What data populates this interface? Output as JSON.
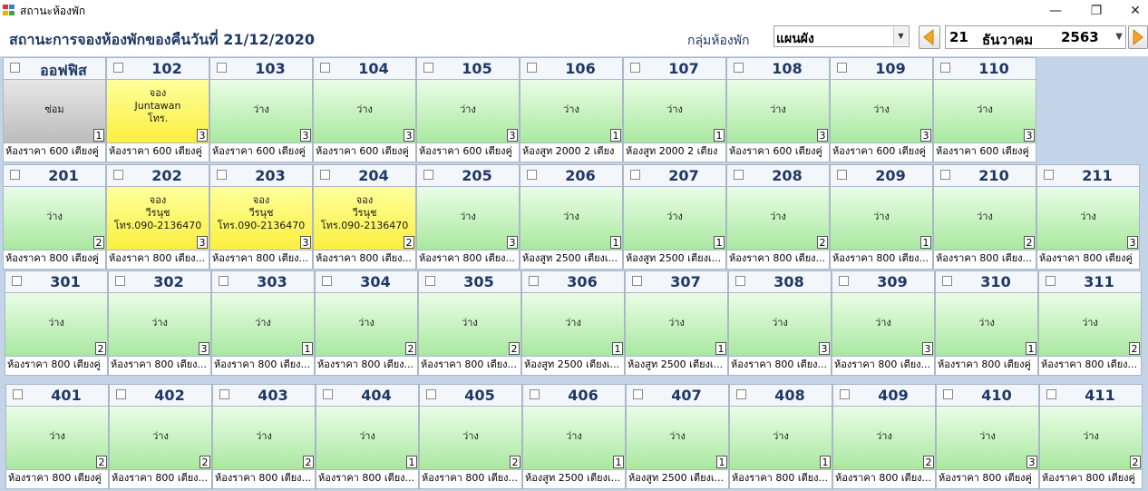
{
  "window": {
    "title": "สถานะห้องพัก",
    "minimize": "—",
    "restore": "❐",
    "close": "✕"
  },
  "header": {
    "title": "สถานะการจองห้องพักของคืนวันที่ 21/12/2020",
    "group_label": "กลุ่มห้องพัก",
    "group_value": "แผนผัง",
    "date_day": "21",
    "date_month": "ธันวาคม",
    "date_year": "2563"
  },
  "colors": {
    "available": "#b5ecac",
    "booked": "#fcf24a",
    "repair": "#c8c8c8",
    "accent": "#1f3864"
  },
  "floors": [
    {
      "rooms": [
        {
          "number": "ออฟฟิส",
          "status": "ซ่อม",
          "state": "repair",
          "beds": "1",
          "type": "ห้องราคา 600 เตียงคู่"
        },
        {
          "number": "102",
          "status": "จอง\nJuntawan\nโทร.",
          "state": "booked",
          "beds": "3",
          "type": "ห้องราคา 600 เตียงคู่"
        },
        {
          "number": "103",
          "status": "ว่าง",
          "state": "avail",
          "beds": "3",
          "type": "ห้องราคา 600 เตียงคู่"
        },
        {
          "number": "104",
          "status": "ว่าง",
          "state": "avail",
          "beds": "3",
          "type": "ห้องราคา 600 เตียงคู่"
        },
        {
          "number": "105",
          "status": "ว่าง",
          "state": "avail",
          "beds": "3",
          "type": "ห้องราคา 600 เตียงคู่"
        },
        {
          "number": "106",
          "status": "ว่าง",
          "state": "avail",
          "beds": "1",
          "type": "ห้องสูท 2000 2 เตียง"
        },
        {
          "number": "107",
          "status": "ว่าง",
          "state": "avail",
          "beds": "1",
          "type": "ห้องสูท 2000 2 เตียง"
        },
        {
          "number": "108",
          "status": "ว่าง",
          "state": "avail",
          "beds": "3",
          "type": "ห้องราคา 600 เตียงคู่"
        },
        {
          "number": "109",
          "status": "ว่าง",
          "state": "avail",
          "beds": "3",
          "type": "ห้องราคา 600 เตียงคู่"
        },
        {
          "number": "110",
          "status": "ว่าง",
          "state": "avail",
          "beds": "3",
          "type": "ห้องราคา 600 เตียงคู่"
        }
      ]
    },
    {
      "rooms": [
        {
          "number": "201",
          "status": "ว่าง",
          "state": "avail",
          "beds": "2",
          "type": "ห้องราคา 800 เตียงคู่"
        },
        {
          "number": "202",
          "status": "จอง\nวีรนุช\nโทร.090-2136470",
          "state": "booked",
          "beds": "3",
          "type": "ห้องราคา 800 เตียง..."
        },
        {
          "number": "203",
          "status": "จอง\nวีรนุช\nโทร.090-2136470",
          "state": "booked",
          "beds": "3",
          "type": "ห้องราคา 800 เตียง..."
        },
        {
          "number": "204",
          "status": "จอง\nวีรนุช\nโทร.090-2136470",
          "state": "booked",
          "beds": "2",
          "type": "ห้องราคา 800 เตียง..."
        },
        {
          "number": "205",
          "status": "ว่าง",
          "state": "avail",
          "beds": "3",
          "type": "ห้องราคา 800 เตียง..."
        },
        {
          "number": "206",
          "status": "ว่าง",
          "state": "avail",
          "beds": "1",
          "type": "ห้องสูท 2500 เตียงเ..."
        },
        {
          "number": "207",
          "status": "ว่าง",
          "state": "avail",
          "beds": "1",
          "type": "ห้องสูท 2500 เตียงเ..."
        },
        {
          "number": "208",
          "status": "ว่าง",
          "state": "avail",
          "beds": "2",
          "type": "ห้องราคา 800 เตียง..."
        },
        {
          "number": "209",
          "status": "ว่าง",
          "state": "avail",
          "beds": "1",
          "type": "ห้องราคา 800 เตียง..."
        },
        {
          "number": "210",
          "status": "ว่าง",
          "state": "avail",
          "beds": "2",
          "type": "ห้องราคา 800 เตียง..."
        },
        {
          "number": "211",
          "status": "ว่าง",
          "state": "avail",
          "beds": "3",
          "type": "ห้องราคา 800 เตียงคู่"
        }
      ]
    },
    {
      "rooms": [
        {
          "number": "301",
          "status": "ว่าง",
          "state": "avail",
          "beds": "2",
          "type": "ห้องราคา 800 เตียงคู่"
        },
        {
          "number": "302",
          "status": "ว่าง",
          "state": "avail",
          "beds": "3",
          "type": "ห้องราคา 800 เตียง..."
        },
        {
          "number": "303",
          "status": "ว่าง",
          "state": "avail",
          "beds": "1",
          "type": "ห้องราคา 800 เตียง..."
        },
        {
          "number": "304",
          "status": "ว่าง",
          "state": "avail",
          "beds": "2",
          "type": "ห้องราคา 800 เตียง..."
        },
        {
          "number": "305",
          "status": "ว่าง",
          "state": "avail",
          "beds": "2",
          "type": "ห้องราคา 800 เตียง..."
        },
        {
          "number": "306",
          "status": "ว่าง",
          "state": "avail",
          "beds": "1",
          "type": "ห้องสูท 2500 เตียงเ..."
        },
        {
          "number": "307",
          "status": "ว่าง",
          "state": "avail",
          "beds": "1",
          "type": "ห้องสูท 2500 เตียงเ..."
        },
        {
          "number": "308",
          "status": "ว่าง",
          "state": "avail",
          "beds": "3",
          "type": "ห้องราคา 800 เตียง..."
        },
        {
          "number": "309",
          "status": "ว่าง",
          "state": "avail",
          "beds": "3",
          "type": "ห้องราคา 800 เตียง..."
        },
        {
          "number": "310",
          "status": "ว่าง",
          "state": "avail",
          "beds": "1",
          "type": "ห้องราคา 800 เตียงคู่"
        },
        {
          "number": "311",
          "status": "ว่าง",
          "state": "avail",
          "beds": "2",
          "type": "ห้องราคา 800 เตียง..."
        }
      ]
    },
    {
      "rooms": [
        {
          "number": "401",
          "status": "ว่าง",
          "state": "avail",
          "beds": "2",
          "type": "ห้องราคา 800 เตียงคู่"
        },
        {
          "number": "402",
          "status": "ว่าง",
          "state": "avail",
          "beds": "2",
          "type": "ห้องราคา 800 เตียง..."
        },
        {
          "number": "403",
          "status": "ว่าง",
          "state": "avail",
          "beds": "2",
          "type": "ห้องราคา 800 เตียง..."
        },
        {
          "number": "404",
          "status": "ว่าง",
          "state": "avail",
          "beds": "1",
          "type": "ห้องราคา 800 เตียง..."
        },
        {
          "number": "405",
          "status": "ว่าง",
          "state": "avail",
          "beds": "2",
          "type": "ห้องราคา 800 เตียง..."
        },
        {
          "number": "406",
          "status": "ว่าง",
          "state": "avail",
          "beds": "1",
          "type": "ห้องสูท 2500 เตียงเ..."
        },
        {
          "number": "407",
          "status": "ว่าง",
          "state": "avail",
          "beds": "1",
          "type": "ห้องสูท 2500 เตียงเ..."
        },
        {
          "number": "408",
          "status": "ว่าง",
          "state": "avail",
          "beds": "1",
          "type": "ห้องราคา 800 เตียง..."
        },
        {
          "number": "409",
          "status": "ว่าง",
          "state": "avail",
          "beds": "2",
          "type": "ห้องราคา 800 เตียง..."
        },
        {
          "number": "410",
          "status": "ว่าง",
          "state": "avail",
          "beds": "3",
          "type": "ห้องราคา 800 เตียงคู่"
        },
        {
          "number": "411",
          "status": "ว่าง",
          "state": "avail",
          "beds": "2",
          "type": "ห้องราคา 800 เตียงคู่"
        }
      ]
    }
  ]
}
